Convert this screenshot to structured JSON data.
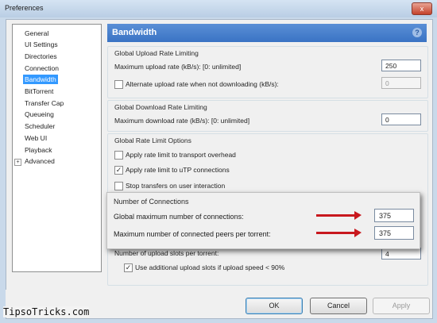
{
  "window": {
    "title": "Preferences",
    "close_glyph": "x"
  },
  "sidebar": {
    "items": [
      {
        "label": "General"
      },
      {
        "label": "UI Settings"
      },
      {
        "label": "Directories"
      },
      {
        "label": "Connection"
      },
      {
        "label": "Bandwidth",
        "selected": true
      },
      {
        "label": "BitTorrent"
      },
      {
        "label": "Transfer Cap"
      },
      {
        "label": "Queueing"
      },
      {
        "label": "Scheduler"
      },
      {
        "label": "Web UI"
      },
      {
        "label": "Playback"
      },
      {
        "label": "Advanced",
        "expandable": true,
        "expander": "+"
      }
    ]
  },
  "panel": {
    "title": "Bandwidth",
    "help_icon": "question-mark-icon",
    "help_glyph": "?",
    "upload": {
      "group_title": "Global Upload Rate Limiting",
      "max_label": "Maximum upload rate (kB/s): [0: unlimited]",
      "max_value": "250",
      "alt_label": "Alternate upload rate when not downloading (kB/s):",
      "alt_value": "0",
      "alt_checked": false
    },
    "download": {
      "group_title": "Global Download Rate Limiting",
      "max_label": "Maximum download rate (kB/s): [0: unlimited]",
      "max_value": "0"
    },
    "options": {
      "group_title": "Global Rate Limit Options",
      "items": [
        {
          "label": "Apply rate limit to transport overhead",
          "checked": false
        },
        {
          "label": "Apply rate limit to uTP connections",
          "checked": true
        },
        {
          "label": "Stop transfers on user interaction",
          "checked": false
        }
      ]
    },
    "slots": {
      "label": "Number of upload slots per torrent:",
      "value": "4",
      "additional_label": "Use additional upload slots if upload speed < 90%",
      "additional_checked": true
    }
  },
  "connections": {
    "group_title": "Number of Connections",
    "global_label": "Global maximum number of connections:",
    "global_value": "375",
    "peers_label": "Maximum number of connected peers per torrent:",
    "peers_value": "375",
    "arrow_color": "#c8181e"
  },
  "footer": {
    "ok": "OK",
    "cancel": "Cancel",
    "apply": "Apply"
  },
  "watermark": "TipsoTricks.com",
  "colors": {
    "accent": "#3a73c4",
    "selection": "#3399ff"
  }
}
